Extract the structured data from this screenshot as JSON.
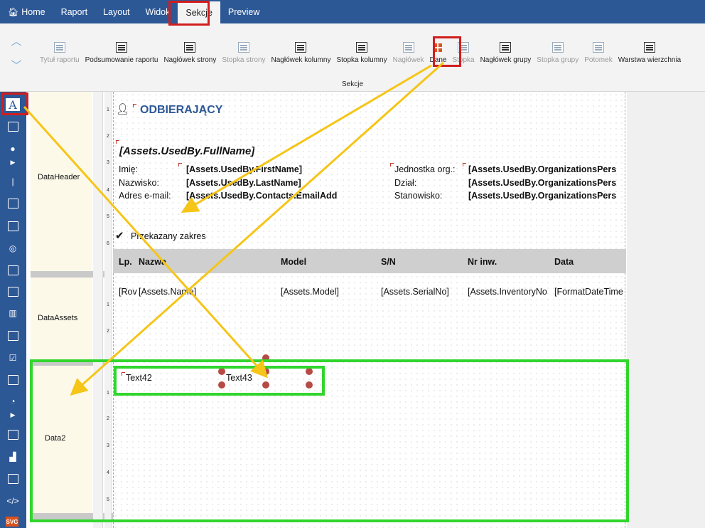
{
  "menu": {
    "items": [
      "Home",
      "Raport",
      "Layout",
      "Widok",
      "Sekcje",
      "Preview"
    ],
    "active": "Sekcje"
  },
  "ribbon": {
    "items": [
      {
        "label": "Tytuł raportu",
        "enabled": false
      },
      {
        "label": "Podsumowanie raportu",
        "enabled": true
      },
      {
        "label": "Nagłówek strony",
        "enabled": true
      },
      {
        "label": "Stopka strony",
        "enabled": false
      },
      {
        "label": "Nagłówek kolumny",
        "enabled": true
      },
      {
        "label": "Stopka kolumny",
        "enabled": true
      },
      {
        "label": "Nagłówek",
        "enabled": false
      },
      {
        "label": "Dane",
        "enabled": true
      },
      {
        "label": "Stopka",
        "enabled": false
      },
      {
        "label": "Nagłówek grupy",
        "enabled": true
      },
      {
        "label": "Stopka grupy",
        "enabled": false
      },
      {
        "label": "Potomek",
        "enabled": false
      },
      {
        "label": "Warstwa wierzchnia",
        "enabled": true
      }
    ],
    "group_label": "Sekcje"
  },
  "toolbar": {
    "icons": [
      "text-object-icon",
      "picture-icon",
      "shape-icon",
      "expand-icon",
      "line-icon",
      "subreport-icon",
      "table-icon",
      "map-icon",
      "chart-icon",
      "matrix-icon",
      "barcode-icon",
      "rich-text-icon",
      "checkbox-icon",
      "cellular-text-icon",
      "gauge-icon",
      "expand-icon",
      "cross-tab-icon",
      "bar-chart-icon",
      "zip-code-icon",
      "html-icon",
      "svg-icon"
    ],
    "svg_label": "SVG"
  },
  "bands": {
    "data_header": "DataHeader",
    "data_assets": "DataAssets",
    "data2": "Data2"
  },
  "ruler_numbers": [
    "1",
    "2",
    "3",
    "4",
    "5",
    "6",
    "1",
    "2",
    "1",
    "2",
    "3",
    "4",
    "5"
  ],
  "header": {
    "title": "ODBIERAJĄCY",
    "full_name": "[Assets.UsedBy.FullName]",
    "labels_left": [
      "Imię:",
      "Nazwisko:",
      "Adres e-mail:"
    ],
    "values_left": [
      "[Assets.UsedBy.FirstName]",
      "[Assets.UsedBy.LastName]",
      "[Assets.UsedBy.Contacts.EmailAdd"
    ],
    "labels_right": [
      "Jednostka org.:",
      "Dział:",
      "Stanowisko:"
    ],
    "values_right": [
      "[Assets.UsedBy.OrganizationsPers",
      "[Assets.UsedBy.OrganizationsPers",
      "[Assets.UsedBy.OrganizationsPers"
    ],
    "section": "Przekazany zakres"
  },
  "table": {
    "columns": [
      "Lp.",
      "Nazwa",
      "Model",
      "S/N",
      "Nr inw.",
      "Data"
    ],
    "row": [
      "[Rov",
      "[Assets.Name]",
      "[Assets.Model]",
      "[Assets.SerialNo]",
      "[Assets.InventoryNo",
      "[FormatDateTime"
    ]
  },
  "data2": {
    "text1": "Text42",
    "text2": "Text43"
  },
  "colors": {
    "menu_bg": "#2d5896",
    "annotation_red": "#d21d1d",
    "annotation_green": "#31d62d",
    "annotation_arrow": "#f5c518",
    "band_label_bg": "#fcf9e9"
  }
}
